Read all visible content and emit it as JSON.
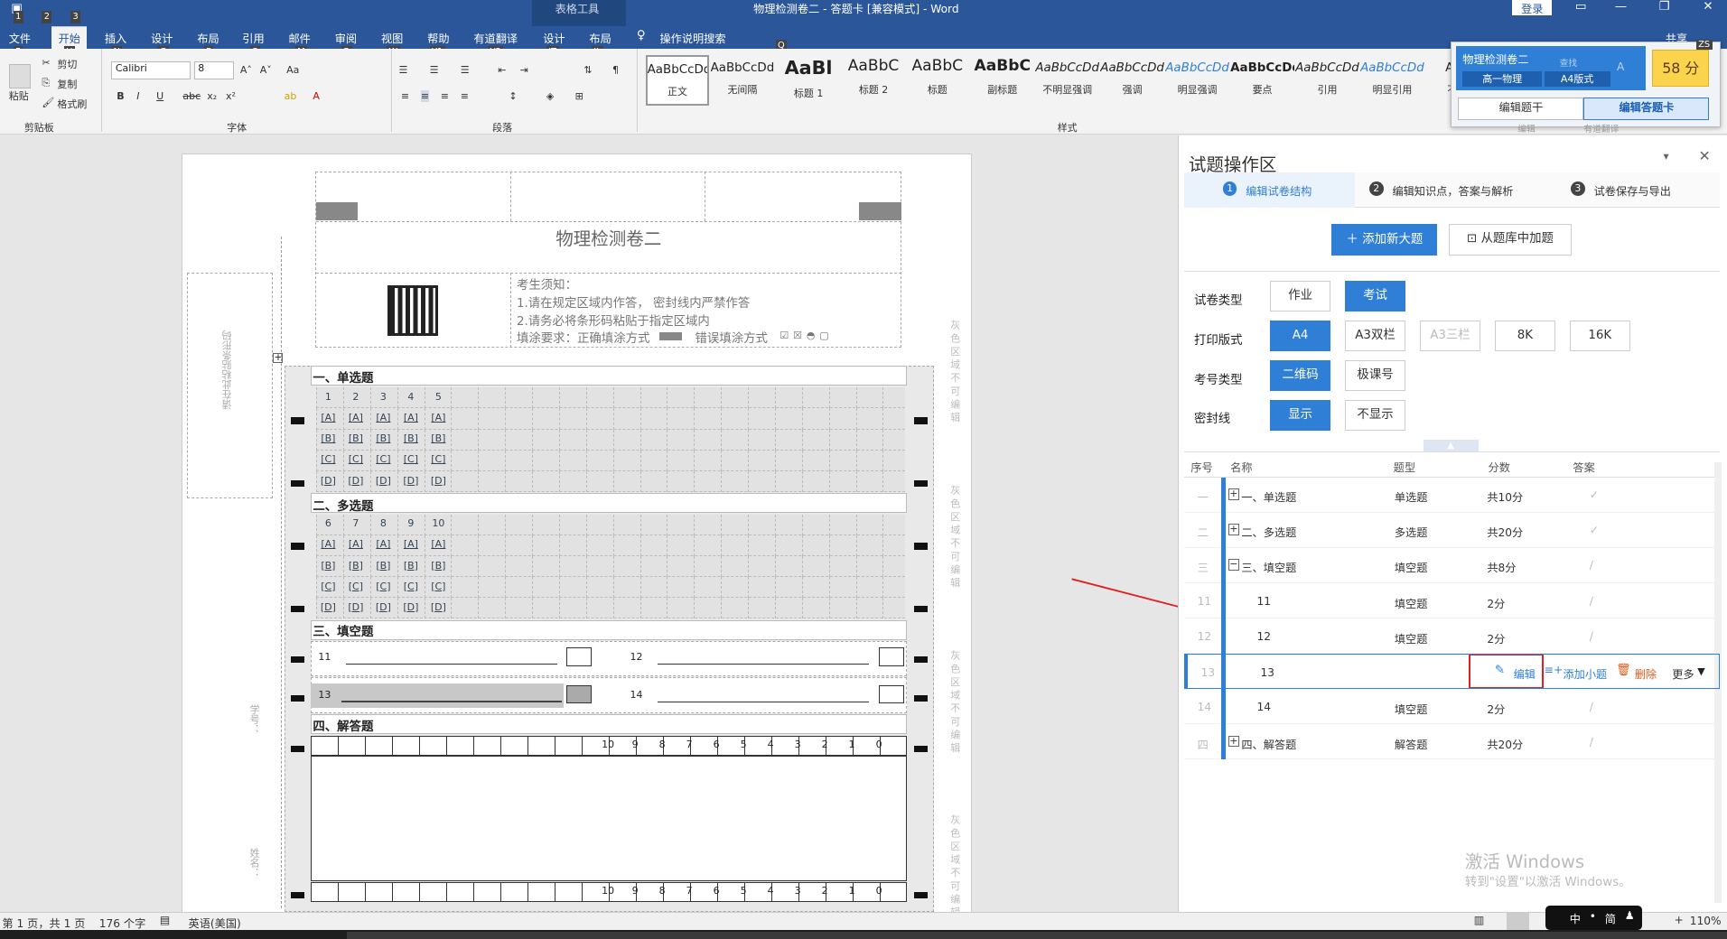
{
  "window": {
    "title": "物理检测卷二 - 答题卡 [兼容模式] - Word",
    "context_tab": "表格工具",
    "login": "登录",
    "share": "共享"
  },
  "qat": {
    "k1": "1",
    "k2": "2",
    "k3": "3"
  },
  "tabs": [
    "文件",
    "开始",
    "插入",
    "设计",
    "布局",
    "引用",
    "邮件",
    "审阅",
    "视图",
    "帮助",
    "有道翻译",
    "设计",
    "布局"
  ],
  "tab_keys": [
    "F",
    "H",
    "N",
    "G",
    "P",
    "S",
    "M",
    "R",
    "W",
    "Y1",
    "Y2",
    "JT",
    "JL"
  ],
  "search_tip": "操作说明搜索",
  "search_key": "Q",
  "clipboard": {
    "paste": "粘贴",
    "cut": "剪切",
    "copy": "复制",
    "format": "格式刷",
    "label": "剪贴板"
  },
  "font": {
    "name": "Calibri",
    "size": "8",
    "label": "字体",
    "aa": "Aa"
  },
  "para": {
    "label": "段落"
  },
  "styles": {
    "label": "样式",
    "items": [
      {
        "sample": "AaBbCcDd",
        "name": "正文"
      },
      {
        "sample": "AaBbCcDd",
        "name": "无间隔"
      },
      {
        "sample": "AaBl",
        "name": "标题 1"
      },
      {
        "sample": "AaBbC",
        "name": "标题 2"
      },
      {
        "sample": "AaBbC",
        "name": "标题"
      },
      {
        "sample": "AaBbC",
        "name": "副标题"
      },
      {
        "sample": "AaBbCcDd",
        "name": "不明显强调"
      },
      {
        "sample": "AaBbCcDd",
        "name": "强调"
      },
      {
        "sample": "AaBbCcDd",
        "name": "明显强调"
      },
      {
        "sample": "AaBbCcDd",
        "name": "要点"
      },
      {
        "sample": "AaBbCcDd",
        "name": "引用"
      },
      {
        "sample": "AaBbCcDd",
        "name": "明显引用"
      },
      {
        "sample": "AaB",
        "name": "不明"
      }
    ]
  },
  "popup": {
    "title": "物理检测卷二",
    "tag1": "高一物理",
    "tag2": "A4版式",
    "score": "58 分",
    "tab1": "编辑题干",
    "tab2": "编辑答题卡",
    "corner": "ZS",
    "ghost1": "查找",
    "ghost2": "编辑",
    "ghost3": "有道翻译"
  },
  "doc": {
    "exam_title": "物理检测卷二",
    "notice_title": "考生须知：",
    "notice1": "1.请在规定区域内作答， 密封线内严禁作答",
    "notice2": "2.请务必将条形码粘贴于指定区域内",
    "fill_req": "填涂要求：正确填涂方式",
    "wrong_fill": "错误填涂方式",
    "barcode_side": "请在此粘贴条形码",
    "gray_note": "灰色区域不可编辑",
    "side_label1": "学号：",
    "side_label2": "姓名：",
    "sec1": "一、单选题",
    "sec2": "二、多选题",
    "sec3": "三、填空题",
    "sec4": "四、解答题",
    "q_row1": [
      "1",
      "2",
      "3",
      "4",
      "5"
    ],
    "q_row2": [
      "6",
      "7",
      "8",
      "9",
      "10"
    ],
    "opts": [
      "[A]",
      "[B]",
      "[C]",
      "[D]"
    ],
    "fill_q": [
      "11",
      "12",
      "13",
      "14"
    ],
    "score_scale": [
      "10",
      "9",
      "8",
      "7",
      "6",
      "5",
      "4",
      "3",
      "2",
      "1",
      "0"
    ]
  },
  "pane": {
    "title": "试题操作区",
    "steps": [
      "编辑试卷结构",
      "编辑知识点，答案与解析",
      "试卷保存与导出"
    ],
    "step_nums": [
      "1",
      "2",
      "3"
    ],
    "add_major": "添加新大题",
    "from_bank": "从题库中加题",
    "exam_type_label": "试卷类型",
    "exam_types": [
      "作业",
      "考试"
    ],
    "print_label": "打印版式",
    "print_opts": [
      "A4",
      "A3双栏",
      "A3三栏",
      "8K",
      "16K"
    ],
    "id_label": "考号类型",
    "id_opts": [
      "二维码",
      "极课号"
    ],
    "seal_label": "密封线",
    "seal_opts": [
      "显示",
      "不显示"
    ],
    "headers": [
      "序号",
      "名称",
      "题型",
      "分数",
      "答案"
    ],
    "rows": [
      {
        "no": "一",
        "name": "一、单选题",
        "type": "单选题",
        "score": "共10分",
        "ans": "✓"
      },
      {
        "no": "二",
        "name": "二、多选题",
        "type": "多选题",
        "score": "共20分",
        "ans": "✓"
      },
      {
        "no": "三",
        "name": "三、填空题",
        "type": "填空题",
        "score": "共8分",
        "ans": "/"
      },
      {
        "no": "11",
        "name": "11",
        "type": "填空题",
        "score": "2分",
        "ans": "/"
      },
      {
        "no": "12",
        "name": "12",
        "type": "填空题",
        "score": "2分",
        "ans": "/"
      },
      {
        "no": "13",
        "name": "13",
        "type": "",
        "score": "",
        "ans": ""
      },
      {
        "no": "14",
        "name": "14",
        "type": "填空题",
        "score": "2分",
        "ans": "/"
      },
      {
        "no": "四",
        "name": "四、解答题",
        "type": "解答题",
        "score": "共20分",
        "ans": "/"
      }
    ],
    "actions": {
      "edit": "编辑",
      "add_sub": "添加小题",
      "del": "删除",
      "more": "更多"
    }
  },
  "status": {
    "page": "第 1 页，共 1 页",
    "words": "176 个字",
    "lang": "英语(美国)",
    "zoom": "110%",
    "ime": "中",
    "ime2": "简"
  },
  "watermark": {
    "line1": "激活 Windows",
    "line2": "转到\"设置\"以激活 Windows。"
  }
}
